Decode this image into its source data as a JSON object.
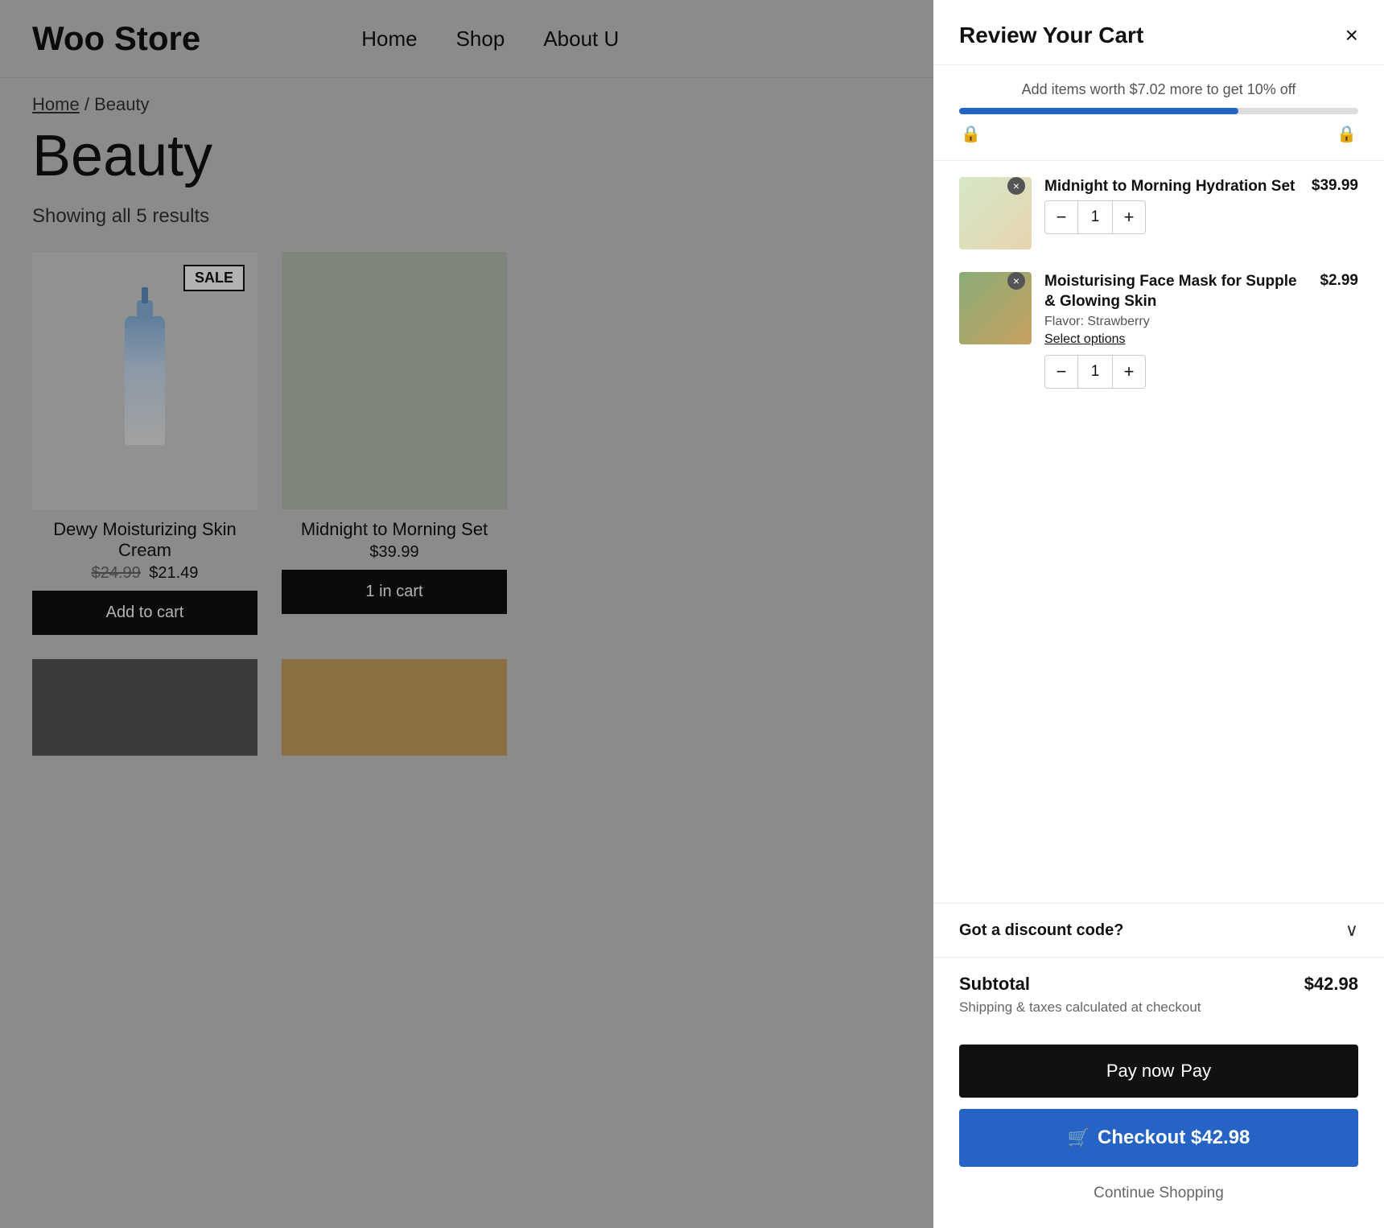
{
  "store": {
    "logo": "Woo Store",
    "nav": {
      "home": "Home",
      "shop": "Shop",
      "about": "About U"
    }
  },
  "breadcrumb": {
    "home_link": "Home",
    "separator": "/",
    "current": "Beauty"
  },
  "page_title": "Beauty",
  "showing_text": "Showing all 5 results",
  "products": [
    {
      "name": "Dewy Moisturizing Skin Cream",
      "price_old": "$24.99",
      "price_new": "$21.49",
      "sale": true,
      "sale_label": "SALE",
      "button_label": "Add to cart",
      "in_cart": false
    },
    {
      "name": "Midnight to Morning\nSet",
      "price": "$39.99",
      "sale": false,
      "in_cart": true,
      "cart_label": "1 in cart"
    }
  ],
  "cart": {
    "title": "Review Your Cart",
    "close_label": "×",
    "progress_text": "Add items worth $7.02 more to get 10% off",
    "progress_percent": 70,
    "items": [
      {
        "name": "Midnight to Morning Hydration Set",
        "price": "$39.99",
        "qty": "1"
      },
      {
        "name": "Moisturising Face Mask for Supple & Glowing Skin",
        "price": "$2.99",
        "qty": "1",
        "meta": "Flavor: Strawberry",
        "option_label": "Select options"
      }
    ],
    "discount_label": "Got a discount code?",
    "subtotal_label": "Subtotal",
    "subtotal_amount": "$42.98",
    "shipping_note": "Shipping & taxes calculated at checkout",
    "pay_now_label": "Pay now",
    "apple_pay_label": "Pay",
    "checkout_label": "Checkout $42.98",
    "continue_label": "Continue Shopping"
  }
}
